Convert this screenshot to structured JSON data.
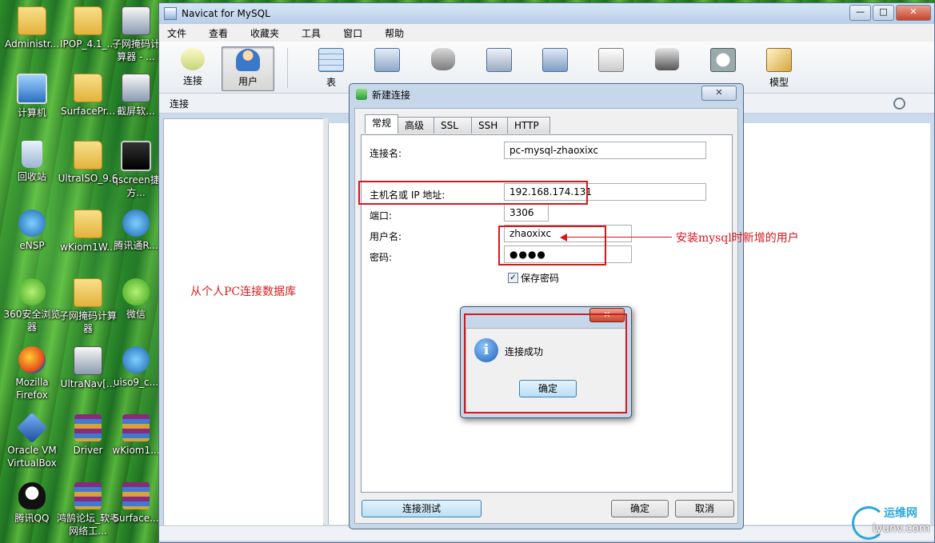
{
  "desktop": {
    "icons": [
      {
        "label": "Administr...",
        "icon": "user-folder-icon"
      },
      {
        "label": "IPOP_4.1_...",
        "icon": "folder-icon"
      },
      {
        "label": "子网掩码计算器 - ...",
        "icon": "app-icon"
      },
      {
        "label": "计算机",
        "icon": "computer-icon"
      },
      {
        "label": "SurfacePr...",
        "icon": "folder-icon"
      },
      {
        "label": "截屏软...",
        "icon": "app-icon"
      },
      {
        "label": "回收站",
        "icon": "recycle-bin-icon"
      },
      {
        "label": "UltraISO_9.6",
        "icon": "folder-icon"
      },
      {
        "label": "qscreen捷方...",
        "icon": "camera-icon"
      },
      {
        "label": "eNSP",
        "icon": "network-icon"
      },
      {
        "label": "wKiom1W...",
        "icon": "folder-icon"
      },
      {
        "label": "腾讯通R...",
        "icon": "app-icon"
      },
      {
        "label": "360安全浏览器",
        "icon": "browser-icon"
      },
      {
        "label": "子网掩码计算器",
        "icon": "folder-icon"
      },
      {
        "label": "微信",
        "icon": "wechat-icon"
      },
      {
        "label": "Mozilla Firefox",
        "icon": "firefox-icon"
      },
      {
        "label": "UltraNav[...",
        "icon": "app-icon"
      },
      {
        "label": "uiso9_c...",
        "icon": "app-icon"
      },
      {
        "label": "Oracle VM VirtualBox",
        "icon": "virtualbox-icon"
      },
      {
        "label": "Driver",
        "icon": "archive-icon"
      },
      {
        "label": "wKiom1...",
        "icon": "archive-icon"
      },
      {
        "label": "腾讯QQ",
        "icon": "qq-icon"
      },
      {
        "label": "鸿鹄论坛_软考网络工...",
        "icon": "archive-icon"
      },
      {
        "label": "Surface...",
        "icon": "archive-icon"
      }
    ]
  },
  "window": {
    "title": "Navicat for MySQL",
    "minimize": "—",
    "maximize": "□",
    "close": "✕"
  },
  "menu": [
    "文件",
    "查看",
    "收藏夹",
    "工具",
    "窗口",
    "帮助"
  ],
  "toolbar": {
    "connect": "连接",
    "user": "用户",
    "table": "表",
    "model": "模型"
  },
  "panebar": {
    "label": "连接"
  },
  "annotation_left": "从个人PC连接数据库",
  "dialog": {
    "title": "新建连接",
    "close": "✕",
    "tabs": [
      "常规",
      "高级",
      "SSL",
      "SSH",
      "HTTP"
    ],
    "fields": {
      "conn_name_label": "连接名:",
      "conn_name_value": "pc-mysql-zhaoxixc",
      "host_label": "主机名或 IP 地址:",
      "host_value": "192.168.174.131",
      "port_label": "端口:",
      "port_value": "3306",
      "user_label": "用户名:",
      "user_value": "zhaoxixc",
      "password_label": "密码:",
      "password_value": "●●●●",
      "save_password_label": "保存密码",
      "save_password_checked": "✓"
    },
    "buttons": {
      "test": "连接测试",
      "ok": "确定",
      "cancel": "取消"
    }
  },
  "annotation_right": "安装mysql时新增的用户",
  "message_box": {
    "close": "✕",
    "icon": "i",
    "text": "连接成功",
    "ok": "确定"
  },
  "watermark": {
    "cn": "运维网",
    "en": "iyunv.com"
  },
  "colors": {
    "annotation_red": "#d9161c",
    "watermark_blue": "#2aa7de"
  }
}
